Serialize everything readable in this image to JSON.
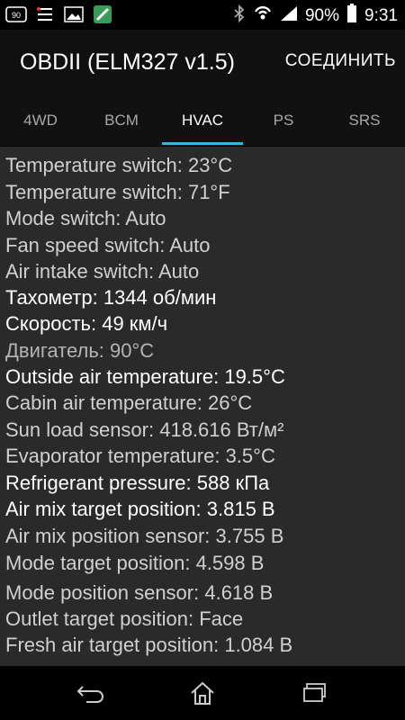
{
  "status_bar": {
    "battery_percent": "90%",
    "time": "9:31",
    "icons": [
      "sim-90-icon",
      "checklist-icon",
      "image-icon",
      "app-icon",
      "bluetooth-icon",
      "wifi-hotspot-icon",
      "signal-icon",
      "battery-icon"
    ]
  },
  "app_bar": {
    "title": "OBDII (ELM327 v1.5)",
    "connect_label": "СОЕДИНИТЬ"
  },
  "tabs": [
    {
      "label": "4WD",
      "active": false
    },
    {
      "label": "BCM",
      "active": false
    },
    {
      "label": "HVAC",
      "active": true
    },
    {
      "label": "PS",
      "active": false
    },
    {
      "label": "SRS",
      "active": false
    }
  ],
  "accent_color": "#33b5e5",
  "readings": [
    {
      "text": "Temperature switch: 23°C",
      "color": "#d0d0d0"
    },
    {
      "text": "Temperature switch: 71°F",
      "color": "#d0d0d0"
    },
    {
      "text": "Mode switch: Auto",
      "color": "#d0d0d0"
    },
    {
      "text": "Fan speed switch: Auto",
      "color": "#d0d0d0"
    },
    {
      "text": "Air intake switch: Auto",
      "color": "#d0d0d0"
    },
    {
      "text": "Тахометр: 1344 об/мин",
      "color": "#ffffff"
    },
    {
      "text": "Скорость: 49 км/ч",
      "color": "#ffffff"
    },
    {
      "text": "Двигатель: 90°C",
      "color": "#b4b4b4"
    },
    {
      "text": "Outside air temperature: 19.5°C",
      "color": "#ffffff"
    },
    {
      "text": "Cabin air temperature: 26°C",
      "color": "#d0d0d0"
    },
    {
      "text": "Sun load sensor: 418.616 Вт/м²",
      "color": "#d0d0d0"
    },
    {
      "text": "Evaporator temperature: 3.5°C",
      "color": "#d0d0d0"
    },
    {
      "text": "Refrigerant pressure: 588 кПа",
      "color": "#ffffff"
    },
    {
      "text": "Air mix target position: 3.815 В",
      "color": "#ffffff"
    },
    {
      "text": "Air mix position sensor: 3.755 В",
      "color": "#d0d0d0"
    },
    {
      "text": "Mode target position: 4.598 В",
      "color": "#d0d0d0"
    },
    {
      "text": "Mode position sensor: 4.618 В",
      "color": "#d0d0d0"
    },
    {
      "text": "Outlet target position: Face",
      "color": "#d0d0d0"
    },
    {
      "text": "Fresh air target position: 1.084 В",
      "color": "#d0d0d0"
    }
  ],
  "nav_bar": {
    "icons": [
      "back-icon",
      "home-icon",
      "recent-apps-icon"
    ]
  }
}
